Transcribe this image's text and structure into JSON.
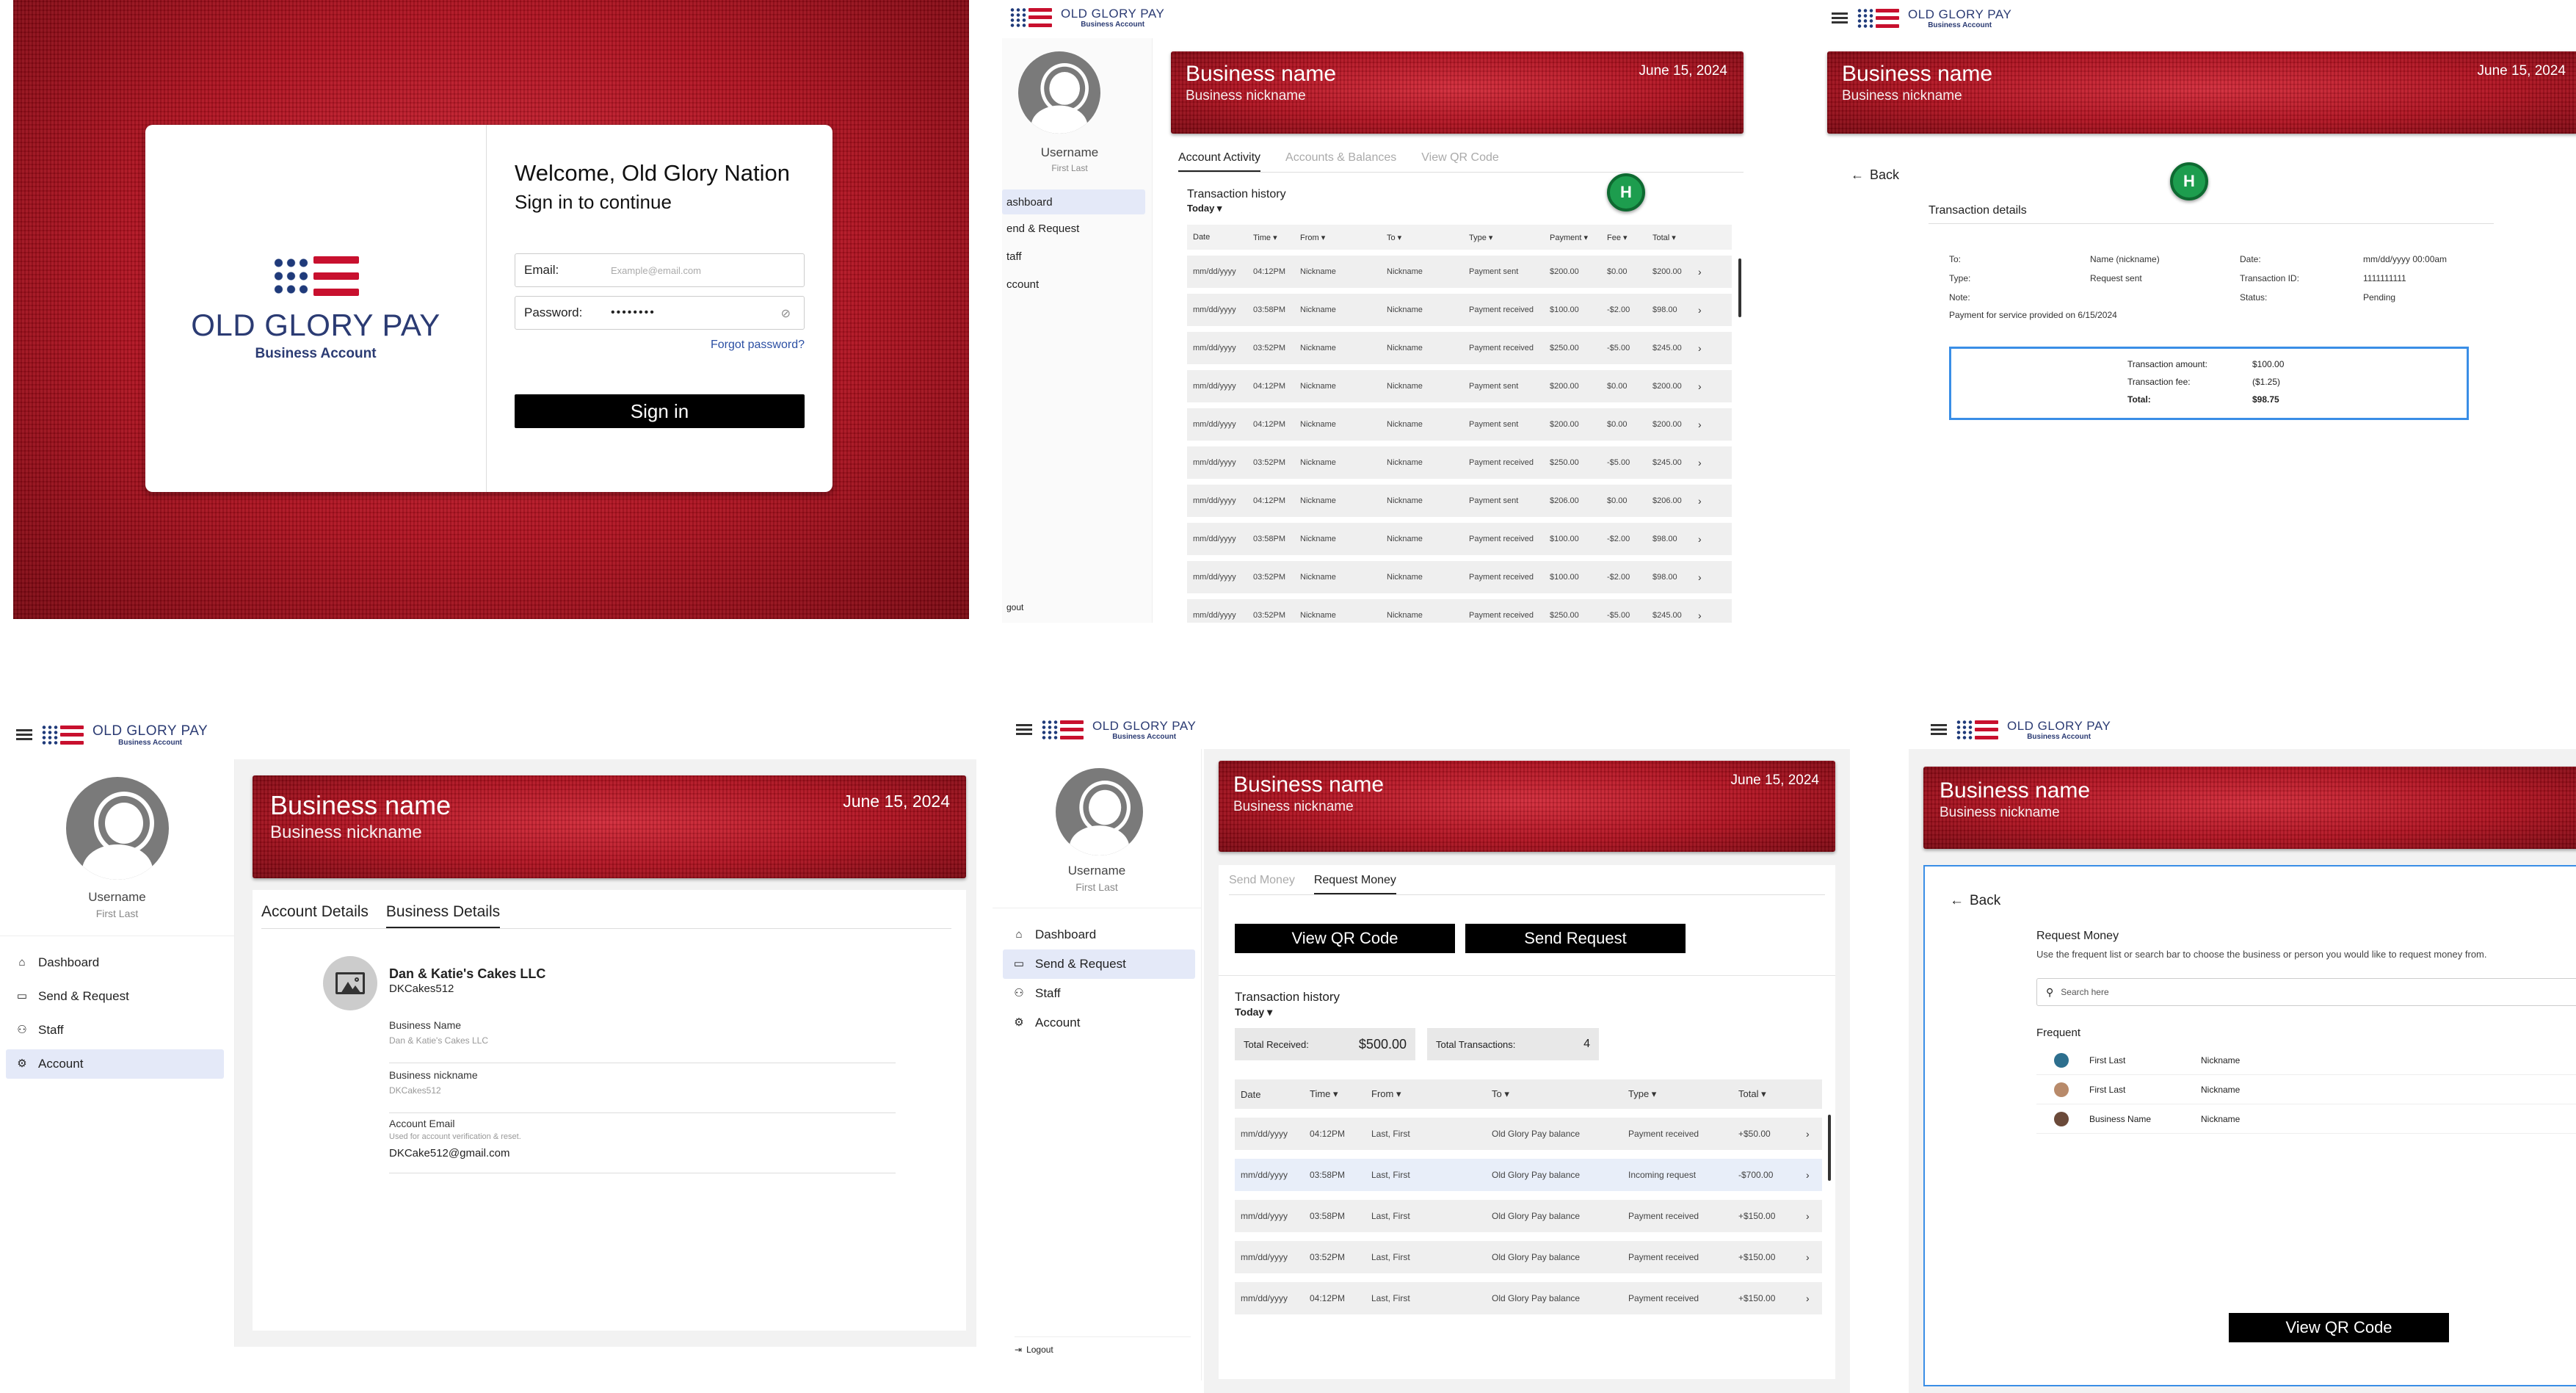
{
  "login": {
    "welcome": "Welcome, Old Glory Nation",
    "subtitle": "Sign in to continue",
    "logo_name": "OLD GLORY PAY",
    "logo_sub": "Business Account",
    "email_label": "Email:",
    "email_placeholder": "Example@email.com",
    "password_label": "Password:",
    "password_value": "••••••••",
    "forgot": "Forgot password?",
    "signin": "Sign in"
  },
  "brand": {
    "name": "OLD GLORY PAY",
    "sub": "Business Account"
  },
  "banner": {
    "business_name": "Business name",
    "nickname": "Business nickname",
    "date": "June 15, 2024"
  },
  "user": {
    "username": "Username",
    "first_last": "First Last"
  },
  "nav": {
    "dashboard": "Dashboard",
    "send_request": "Send & Request",
    "staff": "Staff",
    "account": "Account",
    "logout": "Logout"
  },
  "nav_cut": {
    "dashboard": "ashboard",
    "send_request": "end & Request",
    "staff": "taff",
    "account": "ccount",
    "logout": "gout"
  },
  "activity": {
    "tabs": [
      "Account Activity",
      "Accounts & Balances",
      "View QR Code"
    ],
    "history_title": "Transaction history",
    "filter": "Today ▾",
    "columns": [
      "Date",
      "Time ▾",
      "From ▾",
      "To ▾",
      "Type ▾",
      "Payment ▾",
      "Fee ▾",
      "Total ▾"
    ],
    "rows": [
      [
        "mm/dd/yyyy",
        "04:12PM",
        "Nickname",
        "Nickname",
        "Payment sent",
        "$200.00",
        "$0.00",
        "$200.00"
      ],
      [
        "mm/dd/yyyy",
        "03:58PM",
        "Nickname",
        "Nickname",
        "Payment received",
        "$100.00",
        "-$2.00",
        "$98.00"
      ],
      [
        "mm/dd/yyyy",
        "03:52PM",
        "Nickname",
        "Nickname",
        "Payment received",
        "$250.00",
        "-$5.00",
        "$245.00"
      ],
      [
        "mm/dd/yyyy",
        "04:12PM",
        "Nickname",
        "Nickname",
        "Payment sent",
        "$200.00",
        "$0.00",
        "$200.00"
      ],
      [
        "mm/dd/yyyy",
        "04:12PM",
        "Nickname",
        "Nickname",
        "Payment sent",
        "$200.00",
        "$0.00",
        "$200.00"
      ],
      [
        "mm/dd/yyyy",
        "03:52PM",
        "Nickname",
        "Nickname",
        "Payment received",
        "$250.00",
        "-$5.00",
        "$245.00"
      ],
      [
        "mm/dd/yyyy",
        "04:12PM",
        "Nickname",
        "Nickname",
        "Payment sent",
        "$206.00",
        "$0.00",
        "$206.00"
      ],
      [
        "mm/dd/yyyy",
        "03:58PM",
        "Nickname",
        "Nickname",
        "Payment received",
        "$100.00",
        "-$2.00",
        "$98.00"
      ],
      [
        "mm/dd/yyyy",
        "03:52PM",
        "Nickname",
        "Nickname",
        "Payment received",
        "$100.00",
        "-$2.00",
        "$98.00"
      ],
      [
        "mm/dd/yyyy",
        "03:52PM",
        "Nickname",
        "Nickname",
        "Payment received",
        "$250.00",
        "-$5.00",
        "$245.00"
      ]
    ]
  },
  "badge": "H",
  "details": {
    "back": "Back",
    "title": "Transaction details",
    "to_label": "To:",
    "to_value": "Name (nickname)",
    "type_label": "Type:",
    "type_value": "Request sent",
    "note_label": "Note:",
    "note_value": "Payment for service provided on 6/15/2024",
    "date_label": "Date:",
    "date_value": "mm/dd/yyyy 00:00am",
    "tid_label": "Transaction ID:",
    "tid_value": "1111111111",
    "status_label": "Status:",
    "status_value": "Pending",
    "amount_label": "Transaction amount:",
    "amount_value": "$100.00",
    "fee_label": "Transaction fee:",
    "fee_value": "($1.25)",
    "total_label": "Total:",
    "total_value": "$98.75"
  },
  "account": {
    "tabs": [
      "Account Details",
      "Business Details"
    ],
    "biz_title": "Dan & Katie's Cakes LLC",
    "biz_handle": "DKCakes512",
    "fields": [
      {
        "label": "Business Name",
        "value": "Dan & Katie's Cakes LLC"
      },
      {
        "label": "Business nickname",
        "value": "DKCakes512"
      }
    ],
    "email_label": "Account Email",
    "email_help": "Used for account verification & reset.",
    "email_value": "DKCake512@gmail.com"
  },
  "sendreq": {
    "tabs": [
      "Send Money",
      "Request Money"
    ],
    "view_qr": "View QR Code",
    "send_request": "Send Request",
    "history_title": "Transaction history",
    "filter": "Today ▾",
    "total_received_label": "Total Received:",
    "total_received": "$500.00",
    "total_tx_label": "Total Transactions:",
    "total_tx": "4",
    "columns": [
      "Date",
      "Time ▾",
      "From ▾",
      "To ▾",
      "Type ▾",
      "Total ▾"
    ],
    "rows": [
      [
        "mm/dd/yyyy",
        "04:12PM",
        "Last, First",
        "Old Glory Pay balance",
        "Payment received",
        "+$50.00"
      ],
      [
        "mm/dd/yyyy",
        "03:58PM",
        "Last, First",
        "Old Glory Pay balance",
        "Incoming request",
        "-$700.00"
      ],
      [
        "mm/dd/yyyy",
        "03:58PM",
        "Last, First",
        "Old Glory Pay balance",
        "Payment received",
        "+$150.00"
      ],
      [
        "mm/dd/yyyy",
        "03:52PM",
        "Last, First",
        "Old Glory Pay balance",
        "Payment received",
        "+$150.00"
      ],
      [
        "mm/dd/yyyy",
        "04:12PM",
        "Last, First",
        "Old Glory Pay balance",
        "Payment received",
        "+$150.00"
      ]
    ]
  },
  "reqmoney": {
    "back": "Back",
    "title": "Request Money",
    "help": "Use the frequent list or search bar to choose the business or person you would like to request money from.",
    "search_placeholder": "Search here",
    "frequent": "Frequent",
    "contacts": [
      {
        "name": "First Last",
        "nick": "Nickname"
      },
      {
        "name": "First Last",
        "nick": "Nickname"
      },
      {
        "name": "Business Name",
        "nick": "Nickname"
      }
    ],
    "view_qr": "View QR Code"
  },
  "colors": {
    "brand_navy": "#2b3b73",
    "brand_red": "#c8102e",
    "accent_green": "#1d9d4e",
    "highlight_blue": "#3a8ee6"
  }
}
